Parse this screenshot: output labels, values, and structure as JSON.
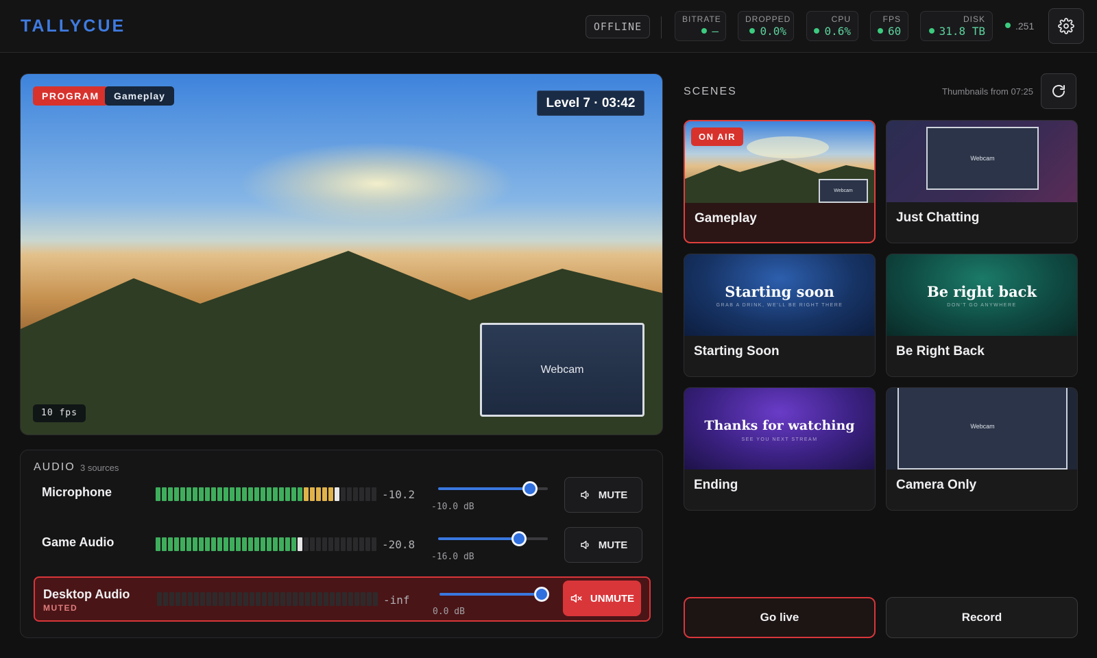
{
  "app": {
    "brand": "TALLYCUE"
  },
  "header": {
    "status": "OFFLINE",
    "stats": [
      {
        "label": "BITRATE",
        "value": "—"
      },
      {
        "label": "DROPPED",
        "value": "0.0%"
      },
      {
        "label": "CPU",
        "value": "0.6%"
      },
      {
        "label": "FPS",
        "value": "60"
      },
      {
        "label": "DISK",
        "value": "31.8 TB"
      }
    ],
    "connection": ".251",
    "status_color": "#3ccb7f"
  },
  "program": {
    "badge": "PROGRAM",
    "scene": "Gameplay",
    "hud": "Level 7 · 03:42",
    "webcam_label": "Webcam",
    "fps": "10 fps"
  },
  "audio": {
    "title": "AUDIO",
    "count": "3 sources",
    "tracks": [
      {
        "name": "Microphone",
        "level": "-10.2",
        "db": "-10.0 dB",
        "button": "MUTE",
        "meter_fraction": 0.84,
        "slider_fraction": 0.84,
        "muted": false
      },
      {
        "name": "Game Audio",
        "level": "-20.8",
        "db": "-16.0 dB",
        "button": "MUTE",
        "meter_fraction": 0.66,
        "slider_fraction": 0.74,
        "muted": false
      },
      {
        "name": "Desktop Audio",
        "sub": "MUTED",
        "level": "-inf",
        "db": "0.0 dB",
        "button": "UNMUTE",
        "meter_fraction": 0,
        "slider_fraction": 1.0,
        "muted": true
      }
    ]
  },
  "scenes": {
    "title": "SCENES",
    "thumbs_note": "Thumbnails from 07:25",
    "items": [
      {
        "name": "Gameplay",
        "badge": "ON AIR",
        "webcam": "Webcam"
      },
      {
        "name": "Just Chatting",
        "webcam": "Webcam"
      },
      {
        "name": "Starting Soon",
        "thumb_title": "Starting soon",
        "thumb_sub": "GRAB A DRINK, WE'LL BE RIGHT THERE"
      },
      {
        "name": "Be Right Back",
        "thumb_title": "Be right back",
        "thumb_sub": "DON'T GO ANYWHERE"
      },
      {
        "name": "Ending",
        "thumb_title": "Thanks for watching",
        "thumb_sub": "SEE YOU NEXT STREAM"
      },
      {
        "name": "Camera Only",
        "webcam": "Webcam"
      }
    ]
  },
  "actions": {
    "go_live": "Go live",
    "record": "Record"
  },
  "colors": {
    "accent": "#3f7be0",
    "live_red": "#d8322d",
    "meter_green": "#3fae5c",
    "meter_yellow": "#e0b24a"
  }
}
